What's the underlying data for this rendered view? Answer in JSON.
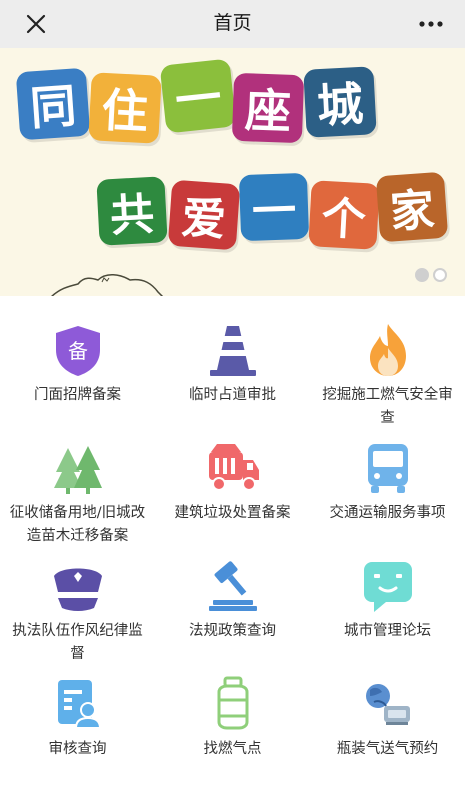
{
  "header": {
    "title": "首页"
  },
  "banner": {
    "line1": [
      "同",
      "住",
      "一",
      "座",
      "城"
    ],
    "line2": [
      "共",
      "爱",
      "一",
      "个",
      "家"
    ],
    "colors1": [
      "#3a7ec4",
      "#f2b13a",
      "#8bbf3c",
      "#b1317c",
      "#2c5f86"
    ],
    "colors2": [
      "#2e8a3f",
      "#c83a3a",
      "#2f7fc0",
      "#e0683d",
      "#b9652a"
    ],
    "slides": 2,
    "active_slide": 1
  },
  "menu": [
    {
      "label": "门面招牌备案",
      "icon": "shield-badge-icon",
      "badge": "备"
    },
    {
      "label": "临时占道审批",
      "icon": "traffic-cone-icon"
    },
    {
      "label": "挖掘施工燃气安全审查",
      "icon": "flame-icon"
    },
    {
      "label": "征收储备用地/旧城改造苗木迁移备案",
      "icon": "trees-icon"
    },
    {
      "label": "建筑垃圾处置备案",
      "icon": "garbage-truck-icon"
    },
    {
      "label": "交通运输服务事项",
      "icon": "bus-icon"
    },
    {
      "label": "执法队伍作风纪律监督",
      "icon": "police-cap-icon"
    },
    {
      "label": "法规政策查询",
      "icon": "gavel-icon"
    },
    {
      "label": "城市管理论坛",
      "icon": "chat-bubble-icon"
    },
    {
      "label": "审核查询",
      "icon": "document-user-icon"
    },
    {
      "label": "找燃气点",
      "icon": "gas-cylinder-icon"
    },
    {
      "label": "瓶装气送气预约",
      "icon": "gas-delivery-icon"
    }
  ]
}
